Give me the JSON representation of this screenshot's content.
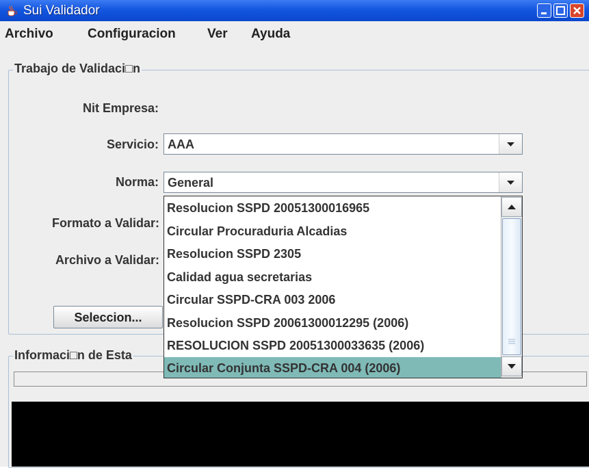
{
  "window": {
    "title": "Sui Validador"
  },
  "menu": {
    "items": [
      "Archivo",
      "Configuracion",
      "Ver",
      "Ayuda"
    ]
  },
  "validation_group": {
    "legend": "Trabajo de Validaci□n",
    "nit_label": "Nit Empresa:",
    "servicio_label": "Servicio:",
    "servicio_value": "AAA",
    "norma_label": "Norma:",
    "norma_value": "General",
    "formato_label": "Formato a Validar:",
    "archivo_label": "Archivo a Validar:",
    "select_button": "Seleccion..."
  },
  "norma_dropdown": {
    "options": [
      "Resolucion SSPD 20051300016965",
      "Circular Procuraduria Alcadias",
      "Resolucion SSPD 2305",
      "Calidad agua secretarias",
      "Circular SSPD-CRA 003 2006",
      "Resolucion SSPD 20061300012295 (2006)",
      "RESOLUCION SSPD 20051300033635 (2006)",
      "Circular Conjunta SSPD-CRA 004 (2006)"
    ],
    "selected_index": 7
  },
  "status_group": {
    "legend": "Informaci□n de Esta"
  },
  "colors": {
    "titlebar": "#0a47cc",
    "selection": "#7fbab7",
    "console": "#000000"
  }
}
